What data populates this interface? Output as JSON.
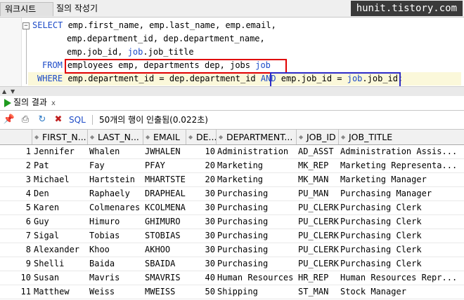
{
  "tabs": {
    "worksheet": "워크시트",
    "query_builder": "질의 작성기"
  },
  "watermark": "hunit.tistory.com",
  "editor": {
    "fold_glyph": "−",
    "line1": {
      "kw": "SELECT",
      "text": " emp.first_name, emp.last_name, emp.email,"
    },
    "line2": "emp.department_id, dep.department_name,",
    "line3": {
      "a": "emp.job_id, ",
      "kw": "job",
      "b": ".job_title"
    },
    "line4": {
      "kw": "FROM",
      "a": "employees emp, departments dep, jobs ",
      "kw2": "job"
    },
    "line5": {
      "kw": "WHERE",
      "a": " emp.department_id = dep.department_id ",
      "kw2": "AND",
      "b": " emp.job_id = ",
      "kw3": "job",
      "c": ".job_id;"
    }
  },
  "results": {
    "tab_label": "질의 결과",
    "close_glyph": "x",
    "toolbar": {
      "sql_label": "SQL",
      "status": "50개의 행이 인출됨(0.022초)"
    },
    "columns": [
      "FIRST_N...",
      "LAST_N...",
      "EMAIL",
      "DE...",
      "DEPARTMENT...",
      "JOB_ID",
      "JOB_TITLE"
    ],
    "rows": [
      [
        "1",
        "Jennifer",
        "Whalen",
        "JWHALEN",
        "10",
        "Administration",
        "AD_ASST",
        "Administration Assis..."
      ],
      [
        "2",
        "Pat",
        "Fay",
        "PFAY",
        "20",
        "Marketing",
        "MK_REP",
        "Marketing Representa..."
      ],
      [
        "3",
        "Michael",
        "Hartstein",
        "MHARTSTE",
        "20",
        "Marketing",
        "MK_MAN",
        "Marketing Manager"
      ],
      [
        "4",
        "Den",
        "Raphaely",
        "DRAPHEAL",
        "30",
        "Purchasing",
        "PU_MAN",
        "Purchasing Manager"
      ],
      [
        "5",
        "Karen",
        "Colmenares",
        "KCOLMENA",
        "30",
        "Purchasing",
        "PU_CLERK",
        "Purchasing Clerk"
      ],
      [
        "6",
        "Guy",
        "Himuro",
        "GHIMURO",
        "30",
        "Purchasing",
        "PU_CLERK",
        "Purchasing Clerk"
      ],
      [
        "7",
        "Sigal",
        "Tobias",
        "STOBIAS",
        "30",
        "Purchasing",
        "PU_CLERK",
        "Purchasing Clerk"
      ],
      [
        "8",
        "Alexander",
        "Khoo",
        "AKHOO",
        "30",
        "Purchasing",
        "PU_CLERK",
        "Purchasing Clerk"
      ],
      [
        "9",
        "Shelli",
        "Baida",
        "SBAIDA",
        "30",
        "Purchasing",
        "PU_CLERK",
        "Purchasing Clerk"
      ],
      [
        "10",
        "Susan",
        "Mavris",
        "SMAVRIS",
        "40",
        "Human Resources",
        "HR_REP",
        "Human Resources Repr..."
      ],
      [
        "11",
        "Matthew",
        "Weiss",
        "MWEISS",
        "50",
        "Shipping",
        "ST_MAN",
        "Stock Manager"
      ]
    ]
  }
}
